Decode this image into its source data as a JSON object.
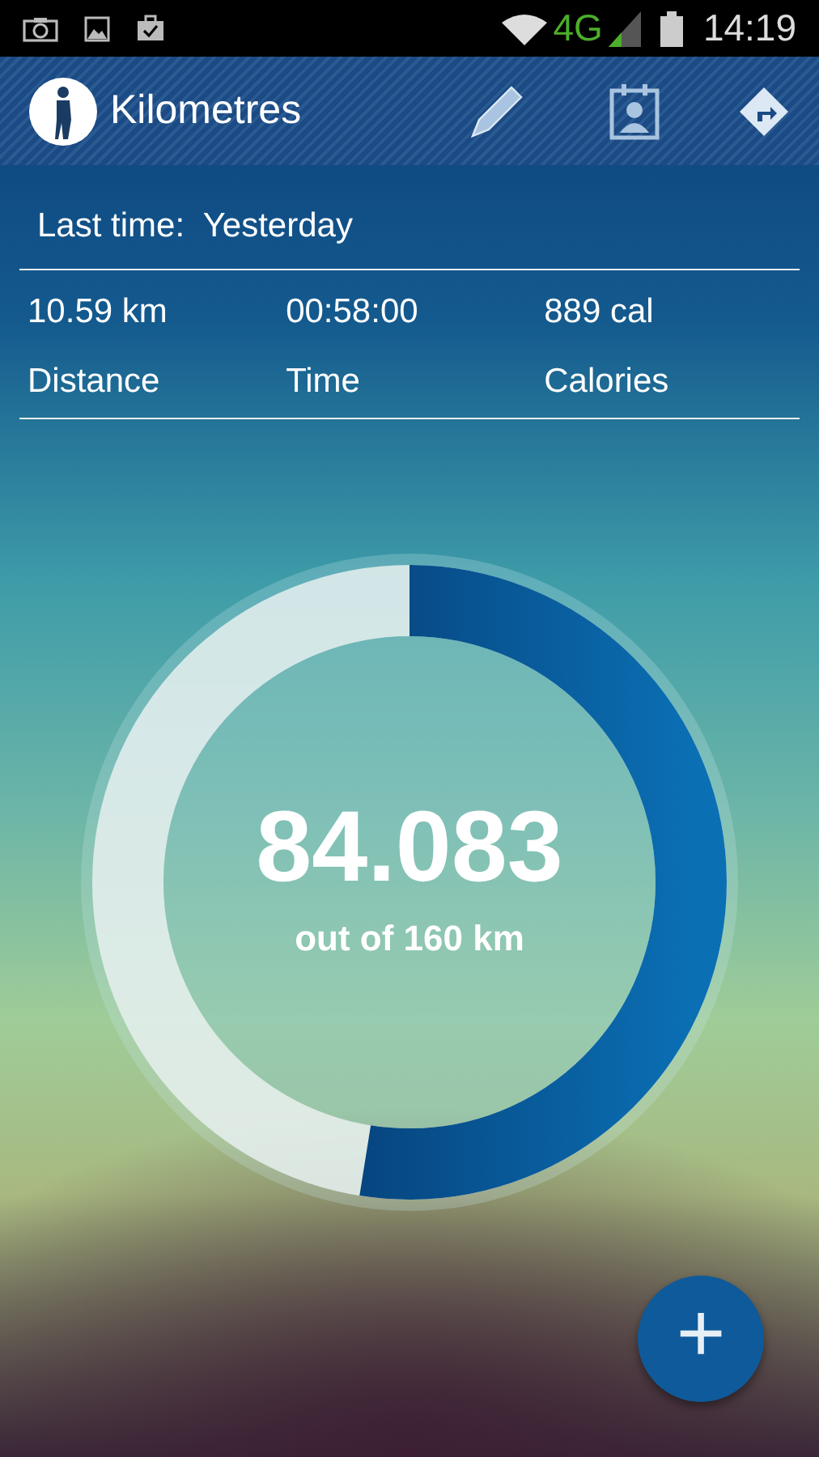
{
  "status_bar": {
    "network": "4G",
    "time": "14:19"
  },
  "app_bar": {
    "title": "Kilometres"
  },
  "last_time": {
    "label": "Last time:",
    "value": "Yesterday"
  },
  "stats": [
    {
      "value": "10.59 km",
      "label": "Distance"
    },
    {
      "value": "00:58:00",
      "label": "Time"
    },
    {
      "value": "889 cal",
      "label": "Calories"
    }
  ],
  "progress": {
    "value": "84.083",
    "caption": "out of 160 km",
    "level": 0.525
  },
  "fab": {
    "label": "+"
  }
}
